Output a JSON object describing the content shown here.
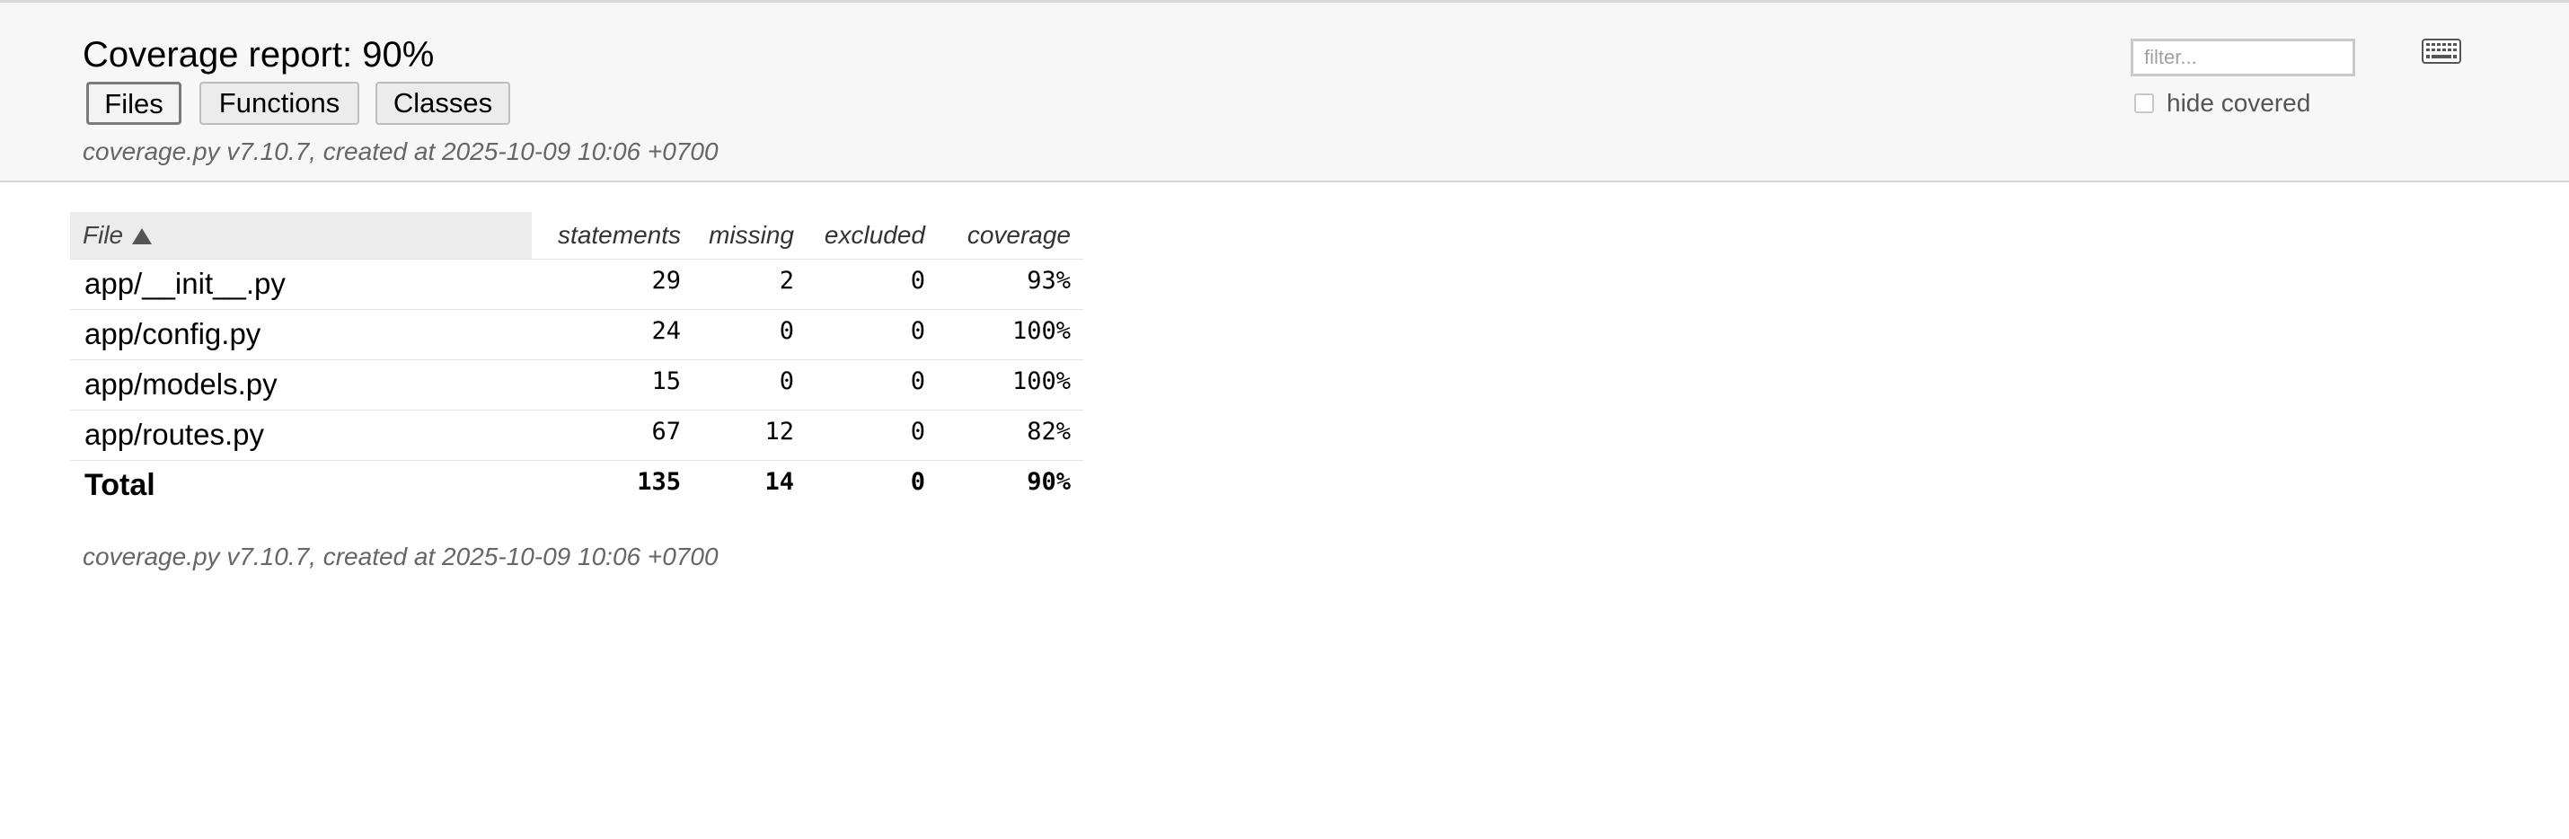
{
  "header": {
    "title": "Coverage report: 90%",
    "tabs": [
      "Files",
      "Functions",
      "Classes"
    ],
    "active_tab": "Files",
    "meta": "coverage.py v7.10.7, created at 2025-10-09 10:06 +0700",
    "filter_placeholder": "filter...",
    "hide_covered_label": "hide covered",
    "hide_covered_checked": false,
    "keyboard_icon": "keyboard-icon"
  },
  "table": {
    "columns": [
      "File",
      "statements",
      "missing",
      "excluded",
      "coverage"
    ],
    "sort": {
      "column": "File",
      "direction": "ascending"
    },
    "rows": [
      {
        "file": "app/__init__.py",
        "statements": "29",
        "missing": "2",
        "excluded": "0",
        "coverage": "93%"
      },
      {
        "file": "app/config.py",
        "statements": "24",
        "missing": "0",
        "excluded": "0",
        "coverage": "100%"
      },
      {
        "file": "app/models.py",
        "statements": "15",
        "missing": "0",
        "excluded": "0",
        "coverage": "100%"
      },
      {
        "file": "app/routes.py",
        "statements": "67",
        "missing": "12",
        "excluded": "0",
        "coverage": "82%"
      }
    ],
    "total": {
      "file": "Total",
      "statements": "135",
      "missing": "14",
      "excluded": "0",
      "coverage": "90%"
    }
  },
  "footer": {
    "meta": "coverage.py v7.10.7, created at 2025-10-09 10:06 +0700"
  }
}
